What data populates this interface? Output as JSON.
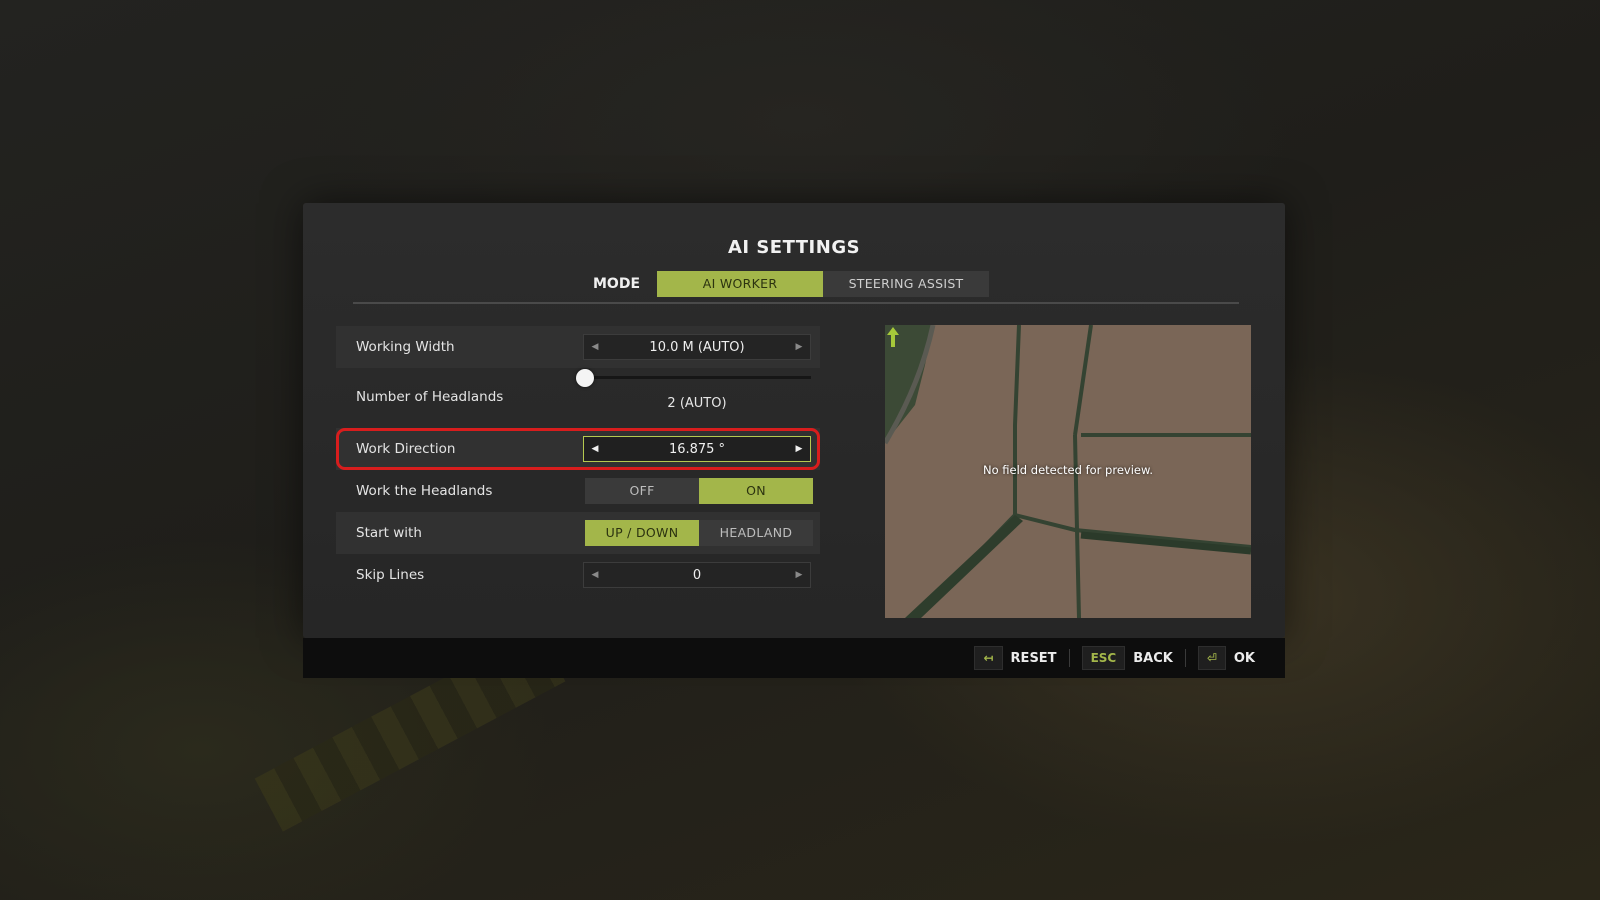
{
  "title": "AI SETTINGS",
  "mode": {
    "label": "MODE",
    "options": [
      "AI WORKER",
      "STEERING ASSIST"
    ],
    "selected": "AI WORKER"
  },
  "settings": {
    "working_width": {
      "label": "Working Width",
      "value": "10.0 M (AUTO)"
    },
    "headlands": {
      "label": "Number of Headlands",
      "value": "2 (AUTO)",
      "slider_fraction": 0.0
    },
    "work_direction": {
      "label": "Work Direction",
      "value": "16.875 °"
    },
    "work_headlands": {
      "label": "Work the Headlands",
      "options": [
        "OFF",
        "ON"
      ],
      "selected": "ON"
    },
    "start_with": {
      "label": "Start with",
      "options": [
        "UP / DOWN",
        "HEADLAND"
      ],
      "selected": "UP / DOWN"
    },
    "skip_lines": {
      "label": "Skip Lines",
      "value": "0"
    }
  },
  "preview": {
    "message": "No field detected for preview."
  },
  "footer": {
    "reset": {
      "key_icon": "double-arrow-icon",
      "label": "RESET"
    },
    "back": {
      "key": "ESC",
      "label": "BACK"
    },
    "ok": {
      "key_icon": "enter-key-icon",
      "label": "OK"
    }
  },
  "colors": {
    "accent": "#a3b64a",
    "highlight_ring": "#d81d1d",
    "panel": "#2c2c2c",
    "footer": "#0d0d0d"
  }
}
